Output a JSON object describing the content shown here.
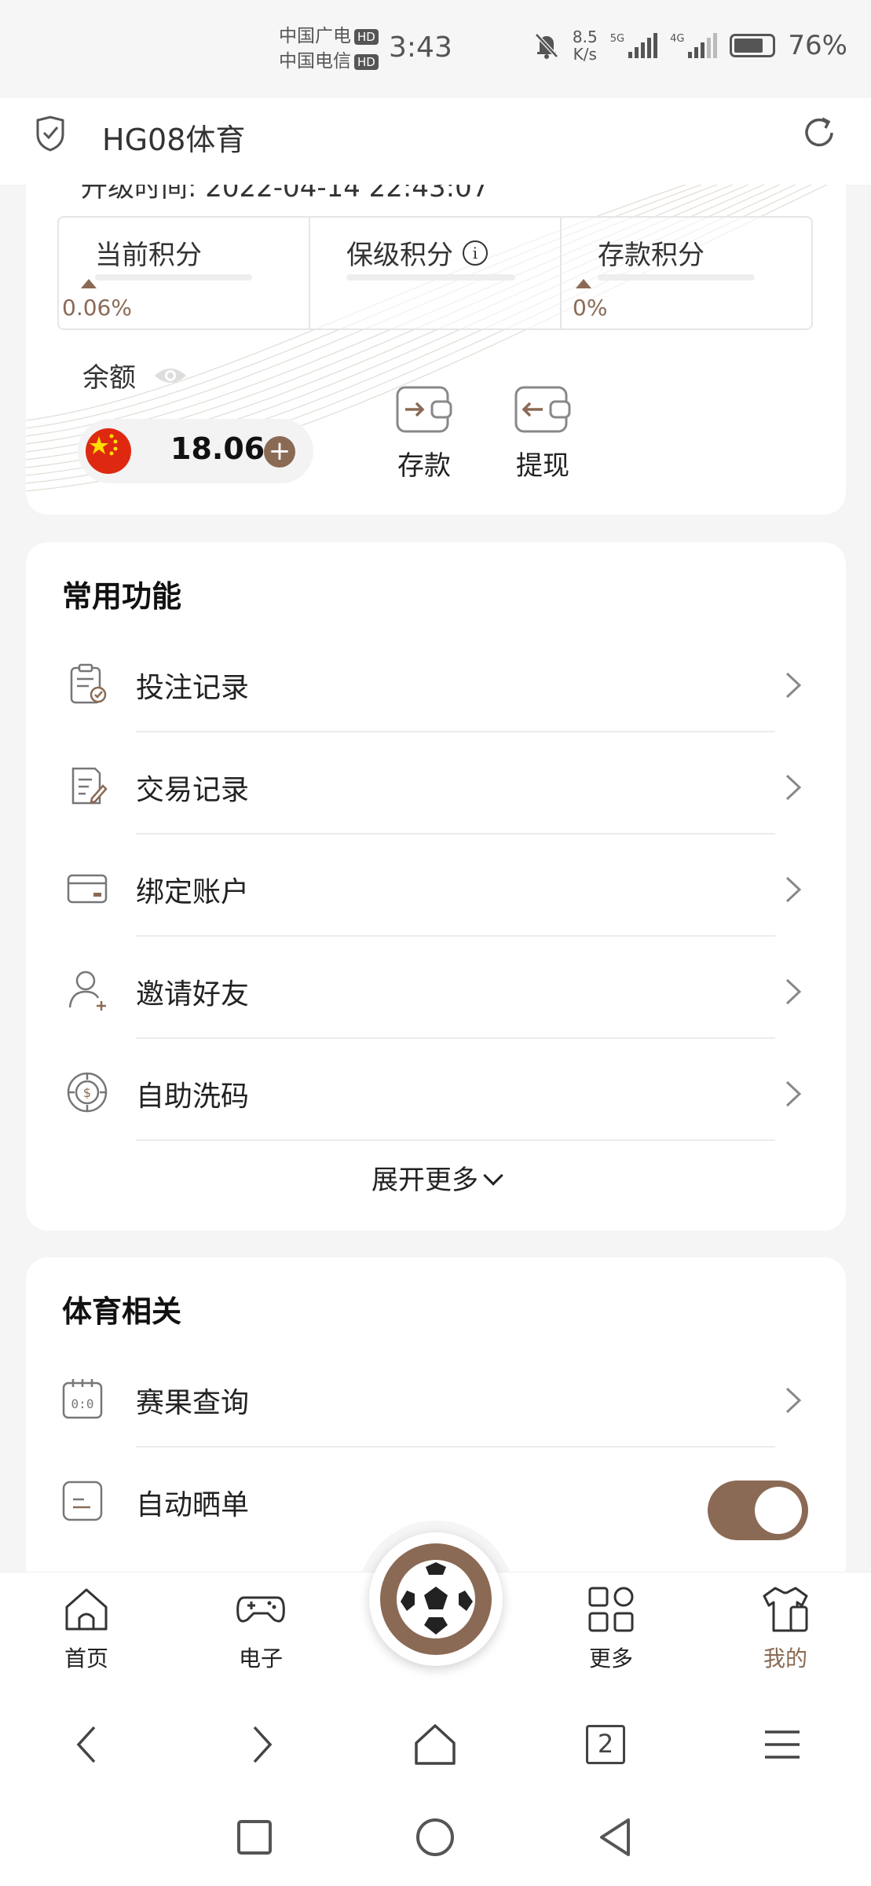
{
  "status_bar": {
    "carrier1": "中国广电",
    "carrier2": "中国电信",
    "hd": "HD",
    "time": "3:43",
    "net_speed_value": "8.5",
    "net_speed_unit": "K/s",
    "sig1": "5G",
    "sig2": "4G",
    "battery": "76%"
  },
  "app_bar": {
    "title": "HG08体育"
  },
  "scores": {
    "partial_text": "升级时间: 2022-04-14 22:43:07",
    "current_label": "当前积分",
    "current_pct": "0.06%",
    "keep_label": "保级积分",
    "deposit_label": "存款积分",
    "deposit_pct": "0%"
  },
  "balance": {
    "label": "余额",
    "value": "18.06",
    "deposit_label": "存款",
    "withdraw_label": "提现"
  },
  "common": {
    "title": "常用功能",
    "items": [
      {
        "label": "投注记录"
      },
      {
        "label": "交易记录"
      },
      {
        "label": "绑定账户"
      },
      {
        "label": "邀请好友"
      },
      {
        "label": "自助洗码"
      }
    ],
    "expand": "展开更多"
  },
  "sports": {
    "title": "体育相关",
    "items": [
      {
        "label": "赛果查询"
      },
      {
        "label": "自动晒单"
      }
    ],
    "auto_share_on": true
  },
  "tabs": [
    {
      "label": "首页"
    },
    {
      "label": "电子"
    },
    {
      "label": "更多"
    },
    {
      "label": "我的"
    }
  ],
  "browser": {
    "tab_count": "2"
  },
  "colors": {
    "accent": "#8a6a55",
    "background": "#f5f5f5"
  }
}
